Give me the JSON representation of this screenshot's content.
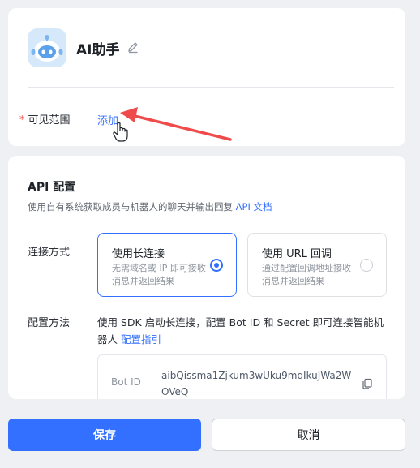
{
  "bot": {
    "name": "AI助手",
    "avatar_icon": "robot-avatar-icon",
    "edit_icon": "pencil-icon"
  },
  "visibility": {
    "label": "可见范围",
    "required_mark": "*",
    "add_link": "添加"
  },
  "api": {
    "title": "API 配置",
    "description": "使用自有系统获取成员与机器人的聊天并输出回复",
    "doc_link": "API 文档",
    "connection_label": "连接方式",
    "options": [
      {
        "title": "使用长连接",
        "desc": "无需域名或 IP 即可接收消息并返回结果",
        "selected": true
      },
      {
        "title": "使用 URL 回调",
        "desc": "通过配置回调地址接收消息并返回结果",
        "selected": false
      }
    ],
    "method_label": "配置方法",
    "method_text": "使用 SDK 启动长连接，配置 Bot ID 和 Secret 即可连接智能机器人",
    "method_link": "配置指引",
    "bot_id_label": "Bot ID",
    "bot_id_value": "aibQissma1Zjkum3wUku9mqIkuJWa2WOVeQ"
  },
  "footer": {
    "save": "保存",
    "cancel": "取消"
  },
  "colors": {
    "accent": "#3370ff",
    "required": "#f54a45",
    "annotation_arrow": "#ef4b4b"
  }
}
